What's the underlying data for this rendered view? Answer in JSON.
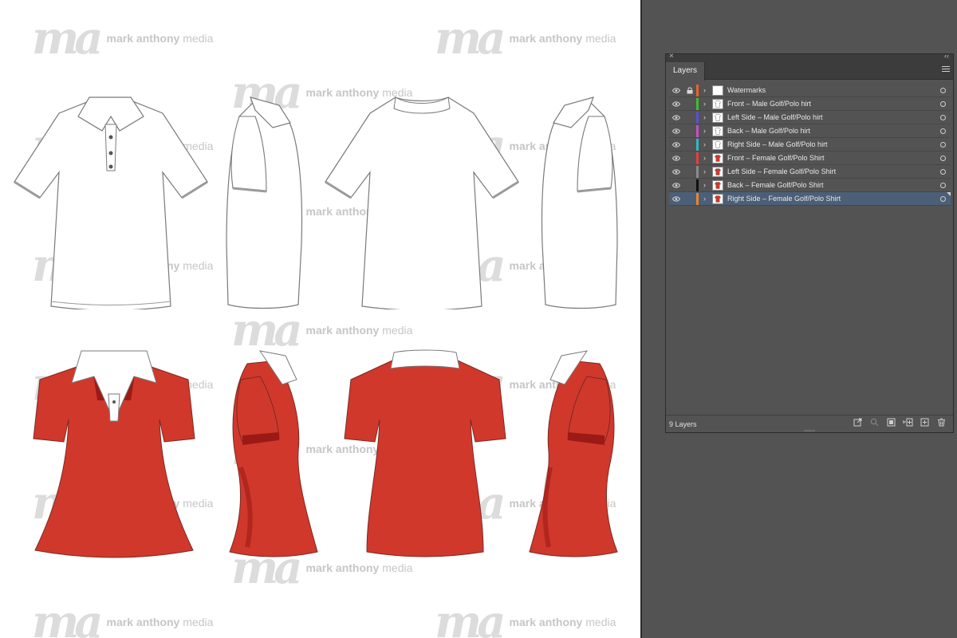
{
  "watermark": {
    "brand_bold": "mark anthony",
    "brand_light": "media",
    "logo": "ma"
  },
  "panel": {
    "tab_label": "Layers",
    "close_glyph": "×",
    "collapse_glyph": "‹‹",
    "layer_count": "9 Layers",
    "layers": [
      {
        "name": "Watermarks",
        "color": "#e8632b",
        "locked": true,
        "thumb": "blank",
        "selected": false
      },
      {
        "name": "Front – Male Golf/Polo hirt",
        "color": "#3fbf2f",
        "locked": false,
        "thumb": "white",
        "selected": false
      },
      {
        "name": "Left Side – Male Golf/Polo hirt",
        "color": "#5a4fd6",
        "locked": false,
        "thumb": "white",
        "selected": false
      },
      {
        "name": "Back – Male Golf/Polo hirt",
        "color": "#c64fc8",
        "locked": false,
        "thumb": "white",
        "selected": false
      },
      {
        "name": "Right Side – Male Golf/Polo hirt",
        "color": "#2fb8c9",
        "locked": false,
        "thumb": "white",
        "selected": false
      },
      {
        "name": "Front – Female Golf/Polo Shirt",
        "color": "#e83c3c",
        "locked": false,
        "thumb": "red",
        "selected": false
      },
      {
        "name": "Left Side – Female Golf/Polo Shirt",
        "color": "#8a8a8a",
        "locked": false,
        "thumb": "red",
        "selected": false
      },
      {
        "name": "Back – Female Golf/Polo Shirt",
        "color": "#111111",
        "locked": false,
        "thumb": "red",
        "selected": false
      },
      {
        "name": "Right Side – Female Golf/Polo Shirt",
        "color": "#e8862b",
        "locked": false,
        "thumb": "red",
        "selected": true
      }
    ],
    "footer_icons": [
      "export-icon",
      "locate-object-icon",
      "make-clipping-mask-icon",
      "create-sublayer-icon",
      "create-new-layer-icon",
      "delete-layer-icon"
    ]
  },
  "colors": {
    "shirt_red": "#d0382c",
    "shirt_red_shade": "#a5201a",
    "line": "#7a7a7a"
  }
}
